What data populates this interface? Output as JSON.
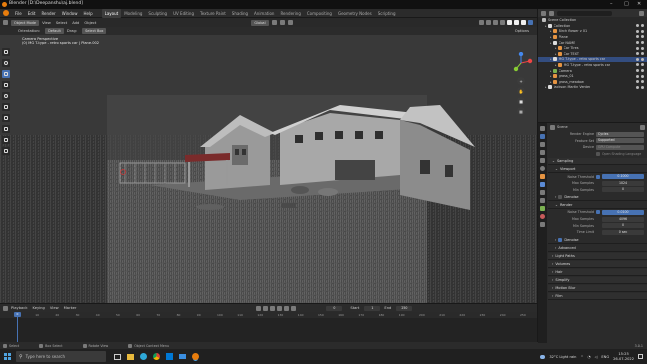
{
  "window": {
    "title": "Blender [D:\\Deepanshu\\aj.blend]"
  },
  "menu": [
    "File",
    "Edit",
    "Render",
    "Window",
    "Help"
  ],
  "workspaces": [
    {
      "label": "Layout",
      "active": true
    },
    {
      "label": "Modeling"
    },
    {
      "label": "Sculpting"
    },
    {
      "label": "UV Editing"
    },
    {
      "label": "Texture Paint"
    },
    {
      "label": "Shading"
    },
    {
      "label": "Animation"
    },
    {
      "label": "Rendering"
    },
    {
      "label": "Compositing"
    },
    {
      "label": "Geometry Nodes"
    },
    {
      "label": "Scripting"
    }
  ],
  "topright": {
    "scene_label": "Scene",
    "view_layer": "ViewLayer"
  },
  "viewport_header": {
    "mode": "Object Mode",
    "view": "View",
    "select": "Select",
    "add": "Add",
    "object": "Object",
    "orientation_label": "Orientation:",
    "orientation": "Default",
    "drag_label": "Drag:",
    "drag": "Select Box",
    "transform": "Global",
    "options": "Options"
  },
  "viewport_info": {
    "line1": "Camera Perspective",
    "line2": "(0) MG T-type - retro sports car | Plane.002"
  },
  "outliner": {
    "title": "Scene Collection",
    "rows": [
      {
        "label": "Collection",
        "indent": 0
      },
      {
        "label": "Birch flower v 01",
        "indent": 1
      },
      {
        "label": "Plane",
        "indent": 1
      },
      {
        "label": "Car NAME",
        "indent": 1
      },
      {
        "label": "Car Tires",
        "indent": 2
      },
      {
        "label": "Car TEXT",
        "indent": 2
      },
      {
        "label": "MG T-type - retro sports car",
        "indent": 1
      },
      {
        "label": "MG T-type - retro sports car",
        "indent": 2
      },
      {
        "label": "Camera",
        "indent": 1
      },
      {
        "label": "grass_01",
        "indent": 1
      },
      {
        "label": "grass_meadow",
        "indent": 1
      },
      {
        "label": "Jackson Martin Venter",
        "indent": 0
      }
    ]
  },
  "properties": {
    "scene": "Scene",
    "render_engine_label": "Render Engine",
    "render_engine": "Cycles",
    "feature_set_label": "Feature Set",
    "feature_set": "Supported",
    "device_label": "Device",
    "device": "GPU Compute",
    "osl": "Open Shading Language",
    "sampling": "Sampling",
    "viewport": "Viewport",
    "noise_threshold_label": "Noise Threshold",
    "vp_noise": "0.1000",
    "max_samples_label": "Max Samples",
    "vp_max": "1024",
    "min_samples_label": "Min Samples",
    "vp_min": "0",
    "denoise": "Denoise",
    "render": "Render",
    "r_noise": "0.0100",
    "r_max": "4096",
    "r_min": "0",
    "time_limit_label": "Time Limit",
    "time_limit": "0 sec",
    "r_denoise": "Denoise",
    "advanced": "Advanced",
    "sections": [
      "Light Paths",
      "Volumes",
      "Hair",
      "Simplify",
      "Motion Blur",
      "Film"
    ]
  },
  "timeline": {
    "menus": [
      "Playback",
      "Keying",
      "View",
      "Marker"
    ],
    "current": "0",
    "start_label": "Start",
    "start": "1",
    "end_label": "End",
    "end": "250",
    "ticks": [
      "0",
      "10",
      "20",
      "30",
      "40",
      "50",
      "60",
      "70",
      "80",
      "90",
      "100",
      "110",
      "120",
      "130",
      "140",
      "150",
      "160",
      "170",
      "180",
      "190",
      "200",
      "210",
      "220",
      "230",
      "240",
      "250"
    ]
  },
  "statusbar": {
    "select": "Select",
    "box": "Box Select",
    "rotate": "Rotate View",
    "menu": "Object Context Menu",
    "version": "3.0.1"
  },
  "taskbar": {
    "search": "Type here to search",
    "weather": "32°C  Light rain",
    "lang": "ENG",
    "time": "15:25",
    "date": "26-07-2022"
  },
  "colors": {
    "accent": "#4772b3",
    "selected": "#334d80",
    "orange": "#e69442",
    "green": "#7bb151"
  }
}
